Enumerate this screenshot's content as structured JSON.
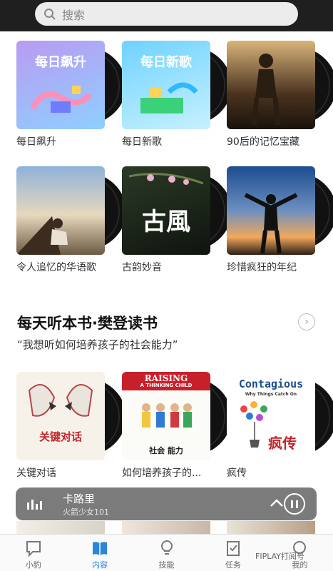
{
  "search": {
    "placeholder": "搜索"
  },
  "row1": [
    {
      "caption": "每日飙升",
      "cover_text": "每日飙升",
      "colors": [
        "#c9a7f5",
        "#9fd7ff"
      ]
    },
    {
      "caption": "每日新歌",
      "cover_text": "每日新歌",
      "colors": [
        "#7fd6ff",
        "#c8f0ff"
      ]
    },
    {
      "caption": "90后的记忆宝藏",
      "cover_text": "",
      "colors": [
        "#3a2a1a",
        "#c79a5c"
      ]
    }
  ],
  "row2": [
    {
      "caption": "令人追忆的华语歌",
      "cover_text": "",
      "colors": [
        "#9fb9d8",
        "#e9d6b8"
      ]
    },
    {
      "caption": "古韵妙音",
      "cover_text": "古風",
      "colors": [
        "#1e2a1e",
        "#5c6f4e"
      ]
    },
    {
      "caption": "珍惜疯狂的年纪",
      "cover_text": "",
      "colors": [
        "#1d4f8c",
        "#f2a55a"
      ]
    }
  ],
  "section": {
    "title": "每天听本书·樊登读书",
    "subtitle": "“我想听如何培养孩子的社会能力”"
  },
  "row3": [
    {
      "caption": "关键对话",
      "cover_text": "关键对话"
    },
    {
      "caption": "如何培养孩子的...",
      "cover_text": "RAISING",
      "cover_sub": "A THINKING CHILD",
      "cover_cn": "社会 能力"
    },
    {
      "caption": "疯传",
      "cover_text": "Contagious",
      "cover_sub": "Why Things Catch On",
      "cover_cn": "疯传"
    }
  ],
  "player": {
    "title": "卡路里",
    "artist": "火箭少女101"
  },
  "tabs": [
    {
      "label": "小豹",
      "icon": "chat-bubble-icon",
      "active": false
    },
    {
      "label": "内容",
      "icon": "book-icon",
      "active": true
    },
    {
      "label": "技能",
      "icon": "lightbulb-icon",
      "active": false
    },
    {
      "label": "任务",
      "icon": "clipboard-icon",
      "active": false
    },
    {
      "label": "我的",
      "icon": "profile-icon",
      "active": false
    }
  ],
  "watermark": "FIPLAY打阅号",
  "colors": {
    "accent": "#2a86d8",
    "player_bg": "#7b7b7b"
  }
}
